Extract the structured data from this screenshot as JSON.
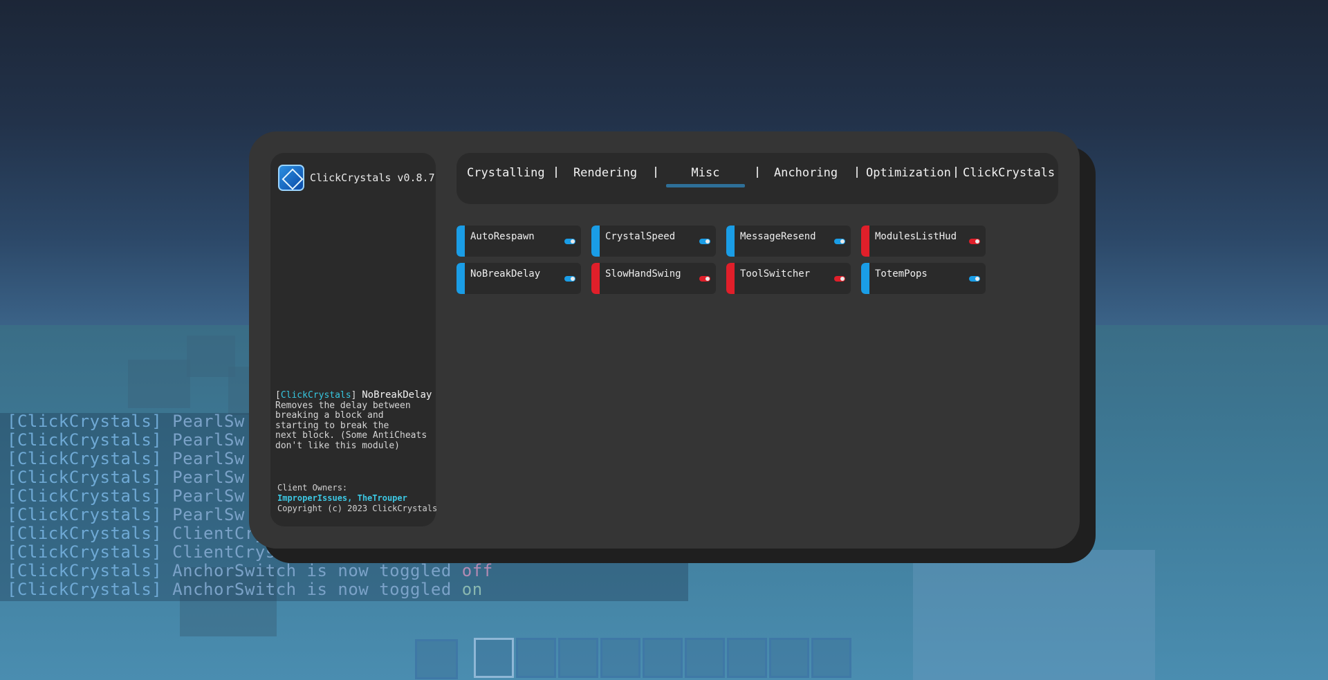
{
  "client": {
    "title": "ClickCrystals v0.8.7",
    "logo_icon": "crystal-logo-icon",
    "accent": "#1a9de6",
    "off_color": "#e01f2a"
  },
  "tabs": [
    {
      "label": "Crystalling"
    },
    {
      "label": "Rendering"
    },
    {
      "label": "Misc",
      "active": true
    },
    {
      "label": "Anchoring"
    },
    {
      "label": "Optimization"
    },
    {
      "label": "ClickCrystals"
    }
  ],
  "modules": [
    {
      "label": "AutoRespawn",
      "enabled": true
    },
    {
      "label": "CrystalSpeed",
      "enabled": true
    },
    {
      "label": "MessageResend",
      "enabled": true
    },
    {
      "label": "ModulesListHud",
      "enabled": false
    },
    {
      "label": "NoBreakDelay",
      "enabled": true
    },
    {
      "label": "SlowHandSwing",
      "enabled": false
    },
    {
      "label": "ToolSwitcher",
      "enabled": false
    },
    {
      "label": "TotemPops",
      "enabled": true
    }
  ],
  "description": {
    "prefix_open": "[",
    "prefix_click": "Click",
    "prefix_crystals": "Crystals",
    "prefix_close": "]",
    "module_name": "NoBreakDelay",
    "lines": [
      "Removes the delay between",
      "breaking a block and",
      "starting to break the",
      "next block. (Some AntiCheats",
      "don't like this module)"
    ]
  },
  "owners": {
    "label": "Client Owners:",
    "names": "ImproperIssues, TheTrouper",
    "copyright": "Copyright (c) 2023 ClickCrystals"
  },
  "chat": [
    {
      "tag": "[ClickCrystals]",
      "msg": "PearlSw"
    },
    {
      "tag": "[ClickCrystals]",
      "msg": "PearlSw"
    },
    {
      "tag": "[ClickCrystals]",
      "msg": "PearlSw"
    },
    {
      "tag": "[ClickCrystals]",
      "msg": "PearlSw"
    },
    {
      "tag": "[ClickCrystals]",
      "msg": "PearlSw"
    },
    {
      "tag": "[ClickCrystals]",
      "msg": "PearlSw"
    },
    {
      "tag": "[ClickCrystals]",
      "msg": "ClientCrys"
    },
    {
      "tag": "[ClickCrystals]",
      "msg": "ClientCrys"
    },
    {
      "tag": "[ClickCrystals]",
      "msg": "AnchorSwitch is now toggled",
      "state": "off"
    },
    {
      "tag": "[ClickCrystals]",
      "msg": "AnchorSwitch is now toggled",
      "state": "on"
    }
  ]
}
